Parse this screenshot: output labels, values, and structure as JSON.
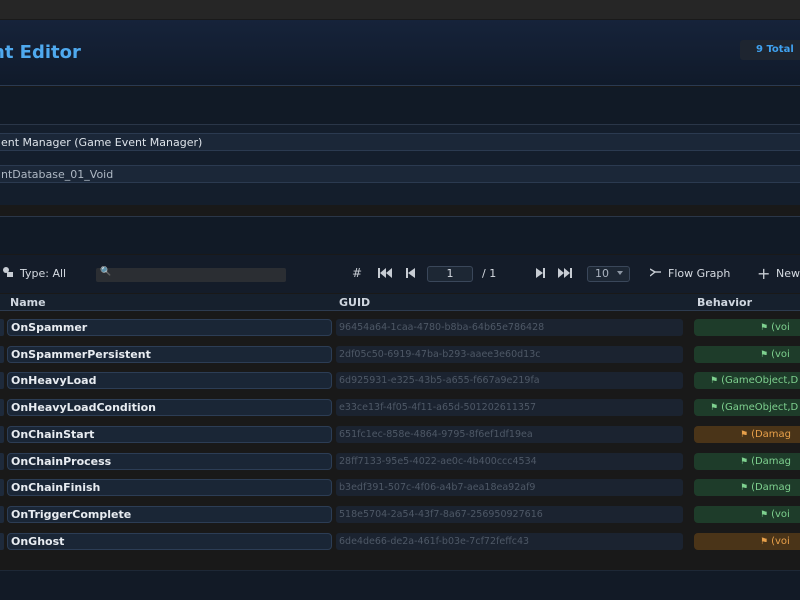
{
  "header": {
    "title": "nt Editor",
    "total_badge": "9 Total"
  },
  "fields": {
    "manager": "ent Manager (Game Event Manager)",
    "database": "ntDatabase_01_Void"
  },
  "toolbar": {
    "type_filter": "Type: All",
    "search_placeholder": "",
    "page_current": "1",
    "page_total": "/ 1",
    "page_size": "10",
    "flow_graph": "Flow Graph",
    "new": "New"
  },
  "columns": {
    "name": "Name",
    "guid": "GUID",
    "behavior": "Behavior"
  },
  "colors": {
    "accent": "#4fa9ee",
    "behavior_green": "#1e3c2a",
    "behavior_orange": "#4a3418"
  },
  "events": [
    {
      "name": "OnSpammer",
      "guid": "96454a64-1caa-4780-b8ba-64b65e786428",
      "behavior": "(voi",
      "status": "green"
    },
    {
      "name": "OnSpammerPersistent",
      "guid": "2df05c50-6919-47ba-b293-aaee3e60d13c",
      "behavior": "(voi",
      "status": "green"
    },
    {
      "name": "OnHeavyLoad",
      "guid": "6d925931-e325-43b5-a655-f667a9e219fa",
      "behavior": "(GameObject,D",
      "status": "green"
    },
    {
      "name": "OnHeavyLoadCondition",
      "guid": "e33ce13f-4f05-4f11-a65d-501202611357",
      "behavior": "(GameObject,D",
      "status": "green"
    },
    {
      "name": "OnChainStart",
      "guid": "651fc1ec-858e-4864-9795-8f6ef1df19ea",
      "behavior": "(Damag",
      "status": "orange"
    },
    {
      "name": "OnChainProcess",
      "guid": "28ff7133-95e5-4022-ae0c-4b400ccc4534",
      "behavior": "(Damag",
      "status": "green"
    },
    {
      "name": "OnChainFinish",
      "guid": "b3edf391-507c-4f06-a4b7-aea18ea92af9",
      "behavior": "(Damag",
      "status": "green"
    },
    {
      "name": "OnTriggerComplete",
      "guid": "518e5704-2a54-43f7-8a67-256950927616",
      "behavior": "(voi",
      "status": "green"
    },
    {
      "name": "OnGhost",
      "guid": "6de4de66-de2a-461f-b03e-7cf72feffc43",
      "behavior": "(voi",
      "status": "orange"
    }
  ]
}
